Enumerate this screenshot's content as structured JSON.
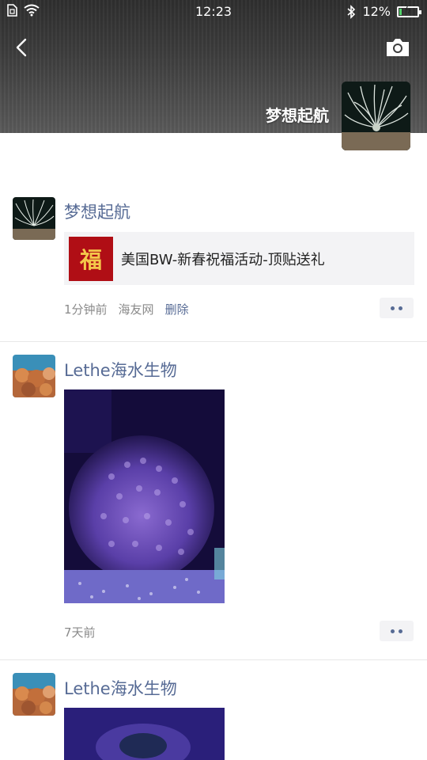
{
  "status_bar": {
    "time": "12:23",
    "battery_percent": "12%",
    "battery_level": 0.12,
    "icons": [
      "sim-icon",
      "wifi-icon",
      "bluetooth-icon",
      "battery-icon"
    ]
  },
  "header": {
    "back_icon": "back-arrow-icon",
    "camera_icon": "camera-icon",
    "profile_name": "梦想起航"
  },
  "posts": [
    {
      "author": "梦想起航",
      "link_title": "美国BW-新春祝福活动-顶贴送礼",
      "link_thumb_text": "福",
      "time": "1分钟前",
      "source": "海友网",
      "delete_label": "删除"
    },
    {
      "author": "Lethe海水生物",
      "time": "7天前"
    },
    {
      "author": "Lethe海水生物"
    }
  ],
  "colors": {
    "name_link": "#576b95",
    "meta_gray": "#8a8a8a",
    "card_bg": "#f3f3f5"
  }
}
